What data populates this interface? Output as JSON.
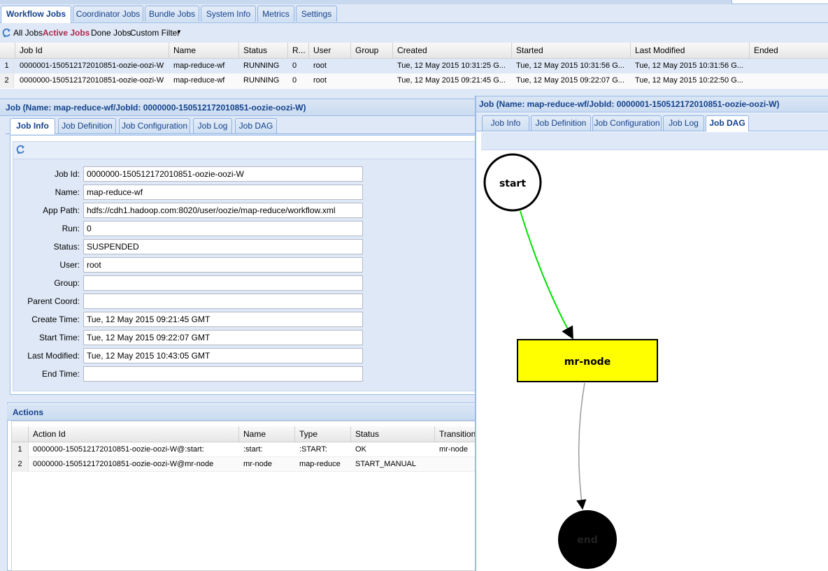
{
  "main_tabs": [
    {
      "label": "Workflow Jobs",
      "active": true
    },
    {
      "label": "Coordinator Jobs",
      "active": false
    },
    {
      "label": "Bundle Jobs",
      "active": false
    },
    {
      "label": "System Info",
      "active": false
    },
    {
      "label": "Metrics",
      "active": false
    },
    {
      "label": "Settings",
      "active": false
    }
  ],
  "filter_bar": {
    "all_jobs": "All Jobs",
    "active_jobs": "Active Jobs",
    "done_jobs": "Done Jobs",
    "custom_filter": "Custom Filter",
    "refresh_icon": "refresh-icon",
    "dropdown_icon": "chevron-down-icon"
  },
  "jobs_grid": {
    "columns": [
      "Job Id",
      "Name",
      "Status",
      "R...",
      "User",
      "Group",
      "Created",
      "Started",
      "Last Modified",
      "Ended"
    ],
    "rows": [
      {
        "num": "1",
        "job_id": "0000001-150512172010851-oozie-oozi-W",
        "name": "map-reduce-wf",
        "status": "RUNNING",
        "run": "0",
        "user": "root",
        "group": "",
        "created": "Tue, 12 May 2015 10:31:25 G...",
        "started": "Tue, 12 May 2015 10:31:56 G...",
        "last_modified": "Tue, 12 May 2015 10:31:56 G...",
        "ended": ""
      },
      {
        "num": "2",
        "job_id": "0000000-150512172010851-oozie-oozi-W",
        "name": "map-reduce-wf",
        "status": "RUNNING",
        "run": "0",
        "user": "root",
        "group": "",
        "created": "Tue, 12 May 2015 09:21:45 G...",
        "started": "Tue, 12 May 2015 09:22:07 G...",
        "last_modified": "Tue, 12 May 2015 10:22:50 G...",
        "ended": ""
      }
    ]
  },
  "left_panel": {
    "title": "Job (Name: map-reduce-wf/JobId: 0000000-150512172010851-oozie-oozi-W)",
    "tabs": [
      "Job Info",
      "Job Definition",
      "Job Configuration",
      "Job Log",
      "Job DAG"
    ],
    "active_tab": "Job Info",
    "form": [
      {
        "label": "Job Id:",
        "value": "0000000-150512172010851-oozie-oozi-W"
      },
      {
        "label": "Name:",
        "value": "map-reduce-wf"
      },
      {
        "label": "App Path:",
        "value": "hdfs://cdh1.hadoop.com:8020/user/oozie/map-reduce/workflow.xml"
      },
      {
        "label": "Run:",
        "value": "0"
      },
      {
        "label": "Status:",
        "value": "SUSPENDED"
      },
      {
        "label": "User:",
        "value": "root"
      },
      {
        "label": "Group:",
        "value": ""
      },
      {
        "label": "Parent Coord:",
        "value": ""
      },
      {
        "label": "Create Time:",
        "value": "Tue, 12 May 2015 09:21:45 GMT"
      },
      {
        "label": "Start Time:",
        "value": "Tue, 12 May 2015 09:22:07 GMT"
      },
      {
        "label": "Last Modified:",
        "value": "Tue, 12 May 2015 10:43:05 GMT"
      },
      {
        "label": "End Time:",
        "value": ""
      }
    ]
  },
  "actions": {
    "title": "Actions",
    "columns": [
      "Action Id",
      "Name",
      "Type",
      "Status",
      "Transition"
    ],
    "rows": [
      {
        "num": "1",
        "action_id": "0000000-150512172010851-oozie-oozi-W@:start:",
        "name": ":start:",
        "type": ":START:",
        "status": "OK",
        "transition": "mr-node"
      },
      {
        "num": "2",
        "action_id": "0000000-150512172010851-oozie-oozi-W@mr-node",
        "name": "mr-node",
        "type": "map-reduce",
        "status": "START_MANUAL",
        "transition": ""
      }
    ]
  },
  "right_panel": {
    "title": "Job (Name: map-reduce-wf/JobId: 0000001-150512172010851-oozie-oozi-W)",
    "tabs": [
      "Job Info",
      "Job Definition",
      "Job Configuration",
      "Job Log",
      "Job DAG"
    ],
    "active_tab": "Job DAG"
  },
  "dag": {
    "nodes": {
      "start": "start",
      "mr_node": "mr-node",
      "end": "end"
    },
    "colors": {
      "start_edge": "#00e000",
      "end_edge": "#a0a0a0",
      "action_fill": "#ffff00",
      "end_fill": "#000000"
    }
  }
}
